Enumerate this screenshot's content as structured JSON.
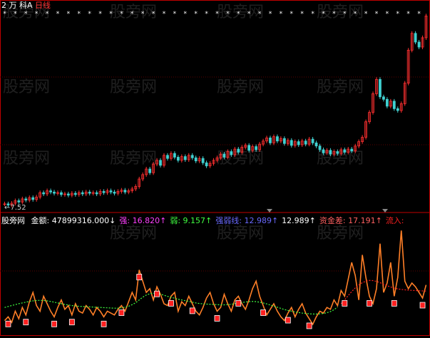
{
  "header": {
    "code": "2",
    "name": "万 科A",
    "period": "日线",
    "colors": {
      "code": "#ffffff",
      "name": "#ffffff",
      "period": "#ff3030"
    }
  },
  "price_panel": {
    "low_label": "7.52"
  },
  "indicator": {
    "name": "股旁网",
    "items": [
      {
        "label": "金额",
        "value": "47899316.000",
        "arrow": "↓",
        "color": "#ffffff"
      },
      {
        "label": "强",
        "value": "16.820",
        "arrow": "↑",
        "color": "#ff40ff"
      },
      {
        "label": "弱",
        "value": "9.157",
        "arrow": "↑",
        "color": "#40ff40"
      },
      {
        "label": "强弱线",
        "value": "12.989",
        "arrow": "↑",
        "color": "#6a6aff"
      },
      {
        "label": "",
        "value": "12.989",
        "arrow": "↑",
        "color": "#ffffff"
      },
      {
        "label": "资金差",
        "value": "17.191",
        "arrow": "↑",
        "color": "#ff6060"
      },
      {
        "label": "流入",
        "value": "",
        "arrow": "",
        "color": "#ff2020"
      }
    ]
  },
  "watermark": "股旁网",
  "colors": {
    "up": "#ff3030",
    "down": "#40d0d0",
    "axis": "#c00000",
    "ind_main": "#ff7f27",
    "ind_signal": "#40ff40",
    "ind_weak": "#ff2020",
    "marker": "#ff2020"
  },
  "chart_data": {
    "type": "line",
    "x": "days",
    "price_series": [
      7.8,
      7.6,
      7.9,
      8.3,
      8.1,
      8.6,
      8.4,
      8.8,
      8.5,
      8.9,
      9.6,
      9.4,
      9.9,
      9.7,
      9.5,
      9.6,
      9.3,
      9.4,
      9.2,
      9.5,
      9.3,
      9.6,
      9.4,
      9.7,
      9.5,
      9.6,
      9.4,
      9.8,
      9.6,
      9.9,
      9.7,
      9.5,
      9.8,
      10.0,
      9.7,
      9.9,
      10.2,
      10.6,
      11.8,
      12.5,
      13.4,
      12.8,
      14.2,
      14.8,
      14.0,
      15.6,
      15.1,
      15.9,
      15.3,
      14.8,
      15.4,
      14.9,
      15.6,
      15.2,
      14.7,
      15.1,
      14.4,
      13.9,
      14.3,
      14.8,
      15.2,
      15.8,
      15.3,
      16.2,
      15.7,
      16.6,
      16.1,
      16.9,
      17.2,
      16.4,
      17.0,
      16.5,
      17.4,
      17.9,
      18.4,
      17.6,
      18.6,
      17.9,
      18.3,
      17.5,
      18.0,
      17.2,
      17.8,
      17.3,
      17.9,
      17.4,
      18.2,
      17.6,
      17.1,
      16.5,
      16.0,
      16.4,
      15.8,
      16.2,
      15.9,
      16.5,
      16.1,
      16.6,
      16.3,
      17.1,
      17.8,
      18.5,
      21.0,
      22.5,
      25.5,
      27.8,
      25.0,
      24.6,
      23.5,
      24.3,
      23.1,
      22.8,
      23.9,
      27.2,
      32.5,
      35.2,
      33.8,
      33.0,
      34.5,
      38.0
    ],
    "indicator_series": [
      7,
      9,
      6,
      12,
      8,
      14,
      10,
      17,
      22,
      15,
      12,
      20,
      16,
      12,
      9,
      14,
      18,
      13,
      15,
      10,
      16,
      12,
      11,
      15,
      13,
      10,
      14,
      12,
      9,
      12,
      11,
      10,
      13,
      15,
      12,
      17,
      22,
      18,
      34,
      28,
      22,
      24,
      18,
      25,
      21,
      16,
      15,
      20,
      22,
      12,
      17,
      15,
      20,
      16,
      12,
      10,
      14,
      19,
      22,
      16,
      12,
      14,
      21,
      16,
      12,
      18,
      20,
      16,
      13,
      18,
      24,
      28,
      20,
      15,
      10,
      13,
      16,
      12,
      9,
      7,
      11,
      14,
      9,
      13,
      16,
      11,
      8,
      5,
      9,
      12,
      11,
      14,
      13,
      18,
      15,
      23,
      20,
      29,
      38,
      31,
      18,
      42,
      30,
      20,
      16,
      24,
      48,
      22,
      27,
      38,
      20,
      30,
      55,
      28,
      24,
      27,
      25,
      22,
      19,
      26
    ],
    "signal_series": [
      14,
      14.5,
      15,
      15.5,
      16,
      16.4,
      16.8,
      17.2,
      17.5,
      17.7,
      17.8,
      17.7,
      17.5,
      17.2,
      16.8,
      16.4,
      16,
      15.6,
      15.3,
      15,
      14.8,
      14.6,
      14.5,
      14.4,
      14.3,
      14.2,
      14.1,
      14,
      13.9,
      13.8,
      13.7,
      13.6,
      13.6,
      13.8,
      14.1,
      14.6,
      15.5,
      16.5,
      18,
      19.5,
      20.6,
      21.3,
      21.6,
      21.5,
      21.1,
      20.5,
      19.9,
      19.4,
      18.9,
      18.4,
      18,
      17.6,
      17.2,
      16.8,
      16.4,
      16.1,
      15.9,
      15.8,
      15.7,
      15.6,
      15.5,
      15.4,
      15.4,
      15.5,
      15.7,
      16,
      16.3,
      16.6,
      16.9,
      17.1,
      17.2,
      17.1,
      16.8,
      16.4,
      15.9,
      15.3,
      14.7,
      14.1,
      13.5,
      12.9,
      12.4,
      12,
      11.6,
      11.3,
      11,
      10.8,
      10.6,
      10.5,
      10.5,
      10.6,
      10.8,
      11.2,
      11.8,
      12.8,
      14.2,
      16,
      18,
      20.3,
      22.5,
      24.4,
      26,
      27.2,
      28,
      28.4,
      28.3,
      27.9,
      27.2,
      26.4,
      25.6,
      24.9,
      24.3,
      23.9,
      23.6,
      23.4,
      23.2,
      23.1,
      23,
      22.9,
      22.8,
      22.7
    ],
    "signal_visible": [
      0,
      95
    ],
    "weak_visible": [
      95,
      120
    ],
    "marker_indices": [
      1,
      6,
      14,
      19,
      28,
      33,
      38,
      43,
      47,
      53,
      60,
      66,
      73,
      80,
      86,
      96,
      103,
      110,
      118
    ]
  }
}
